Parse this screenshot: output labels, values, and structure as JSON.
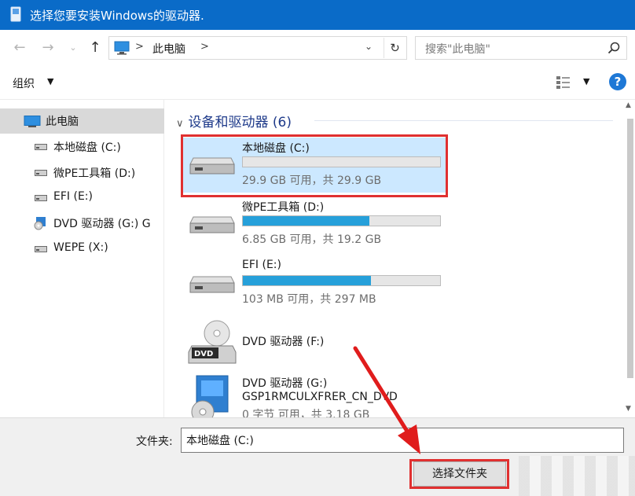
{
  "window": {
    "title": "选择您要安装Windows的驱动器."
  },
  "address_bar": {
    "crumb": "此电脑",
    "separator": ">",
    "search_placeholder": "搜索\"此电脑\""
  },
  "toolbar": {
    "organize_label": "组织",
    "help_label": "?"
  },
  "sidebar": {
    "items": [
      {
        "label": "此电脑",
        "icon": "computer-icon",
        "selected": true
      },
      {
        "label": "本地磁盘 (C:)",
        "icon": "drive-icon"
      },
      {
        "label": "微PE工具箱 (D:)",
        "icon": "drive-icon"
      },
      {
        "label": "EFI (E:)",
        "icon": "drive-icon"
      },
      {
        "label": "DVD 驱动器 (G:) G",
        "icon": "dvd-setup-icon"
      },
      {
        "label": "WEPE (X:)",
        "icon": "drive-icon"
      }
    ]
  },
  "content": {
    "group_title": "设备和驱动器 (6)",
    "drives": [
      {
        "name": "本地磁盘 (C:)",
        "free": "29.9 GB 可用，共 29.9 GB",
        "used_fraction": 0.0,
        "selected": true,
        "icon": "hard-drive-icon"
      },
      {
        "name": "微PE工具箱 (D:)",
        "free": "6.85 GB 可用，共 19.2 GB",
        "used_fraction": 0.64,
        "icon": "hard-drive-icon"
      },
      {
        "name": "EFI (E:)",
        "free": "103 MB 可用，共 297 MB",
        "used_fraction": 0.65,
        "icon": "hard-drive-icon"
      },
      {
        "name": "DVD 驱动器 (F:)",
        "icon": "dvd-drive-icon"
      },
      {
        "name": "DVD 驱动器 (G:)",
        "name_line2": "GSP1RMCULXFRER_CN_DVD",
        "free": "0 字节 可用，共 3.18 GB",
        "icon": "dvd-setup-icon"
      }
    ]
  },
  "bottom": {
    "folder_label": "文件夹:",
    "folder_value": "本地磁盘 (C:)",
    "select_button": "选择文件夹"
  },
  "colors": {
    "titlebar": "#0a6bc8",
    "selection": "#cce8ff",
    "progress": "#26a0da",
    "highlight": "#e03030"
  }
}
